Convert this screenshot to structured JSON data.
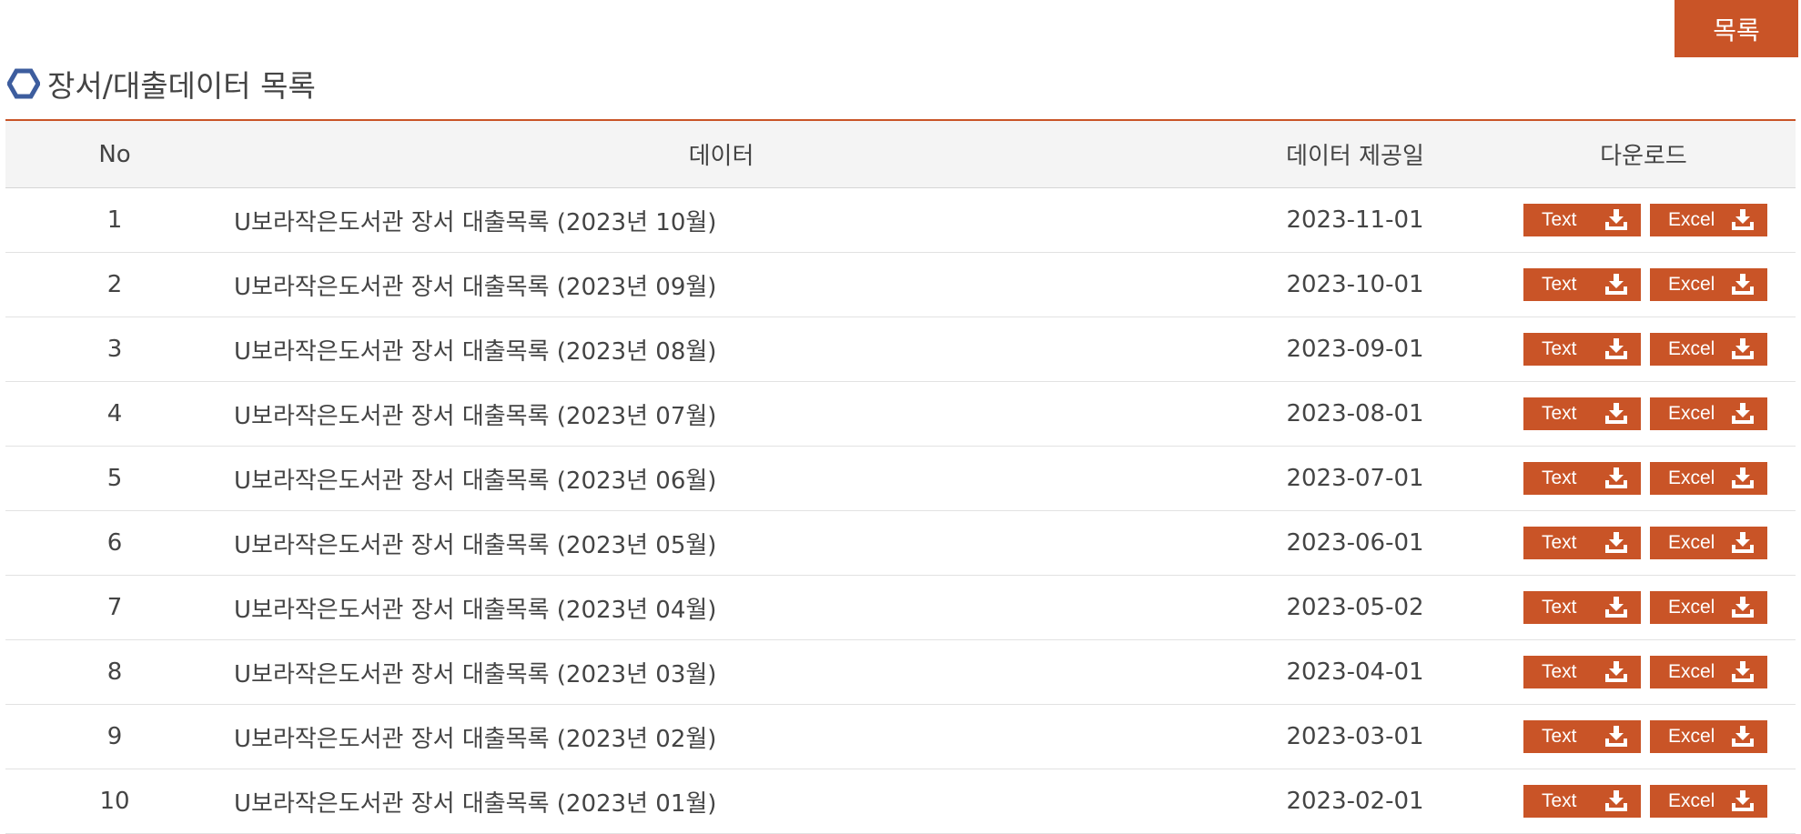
{
  "header": {
    "list_button_label": "목록",
    "section_title": "장서/대출데이터 목록"
  },
  "table": {
    "columns": [
      "No",
      "데이터",
      "데이터 제공일",
      "다운로드"
    ],
    "rows": [
      {
        "no": "1",
        "data": "U보라작은도서관 장서 대출목록 (2023년 10월)",
        "date": "2023-11-01",
        "text_btn": "Text",
        "excel_btn": "Excel"
      },
      {
        "no": "2",
        "data": "U보라작은도서관 장서 대출목록 (2023년 09월)",
        "date": "2023-10-01",
        "text_btn": "Text",
        "excel_btn": "Excel"
      },
      {
        "no": "3",
        "data": "U보라작은도서관 장서 대출목록 (2023년 08월)",
        "date": "2023-09-01",
        "text_btn": "Text",
        "excel_btn": "Excel"
      },
      {
        "no": "4",
        "data": "U보라작은도서관 장서 대출목록 (2023년 07월)",
        "date": "2023-08-01",
        "text_btn": "Text",
        "excel_btn": "Excel"
      },
      {
        "no": "5",
        "data": "U보라작은도서관 장서 대출목록 (2023년 06월)",
        "date": "2023-07-01",
        "text_btn": "Text",
        "excel_btn": "Excel"
      },
      {
        "no": "6",
        "data": "U보라작은도서관 장서 대출목록 (2023년 05월)",
        "date": "2023-06-01",
        "text_btn": "Text",
        "excel_btn": "Excel"
      },
      {
        "no": "7",
        "data": "U보라작은도서관 장서 대출목록 (2023년 04월)",
        "date": "2023-05-02",
        "text_btn": "Text",
        "excel_btn": "Excel"
      },
      {
        "no": "8",
        "data": "U보라작은도서관 장서 대출목록 (2023년 03월)",
        "date": "2023-04-01",
        "text_btn": "Text",
        "excel_btn": "Excel"
      },
      {
        "no": "9",
        "data": "U보라작은도서관 장서 대출목록 (2023년 02월)",
        "date": "2023-03-01",
        "text_btn": "Text",
        "excel_btn": "Excel"
      },
      {
        "no": "10",
        "data": "U보라작은도서관 장서 대출목록 (2023년 01월)",
        "date": "2023-02-01",
        "text_btn": "Text",
        "excel_btn": "Excel"
      }
    ]
  },
  "colors": {
    "accent": "#c95427",
    "header_bg": "#f4f4f4",
    "hex_icon": "#3d5d9e"
  },
  "icons": {
    "title_icon": "hexagon-icon",
    "button_icon": "download-icon"
  }
}
